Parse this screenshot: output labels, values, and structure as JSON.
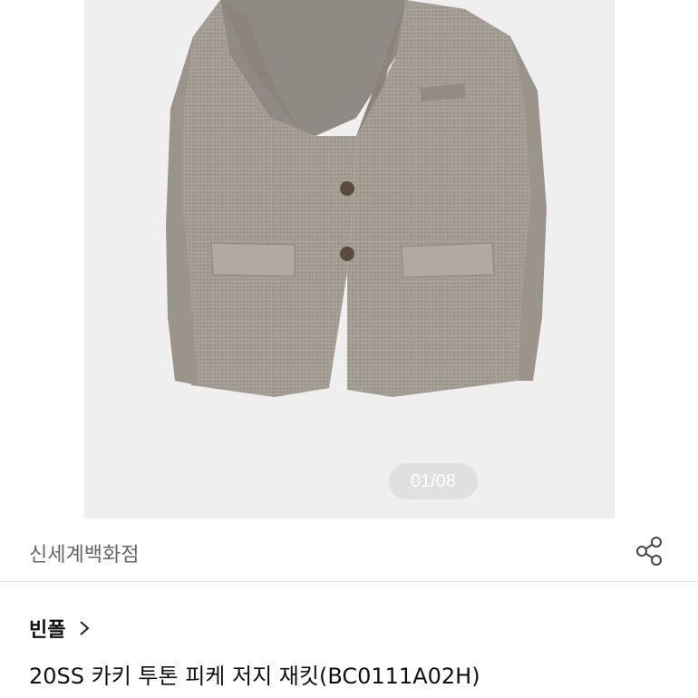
{
  "gallery": {
    "image_alt": "jacket-photo",
    "counter": "01/08"
  },
  "store": {
    "name": "신세계백화점",
    "share_icon": "share-icon"
  },
  "product": {
    "brand": "빈폴",
    "brand_chevron_icon": "chevron-right-icon",
    "title": "20SS 카키 투톤 피케 저지 재킷(BC0111A02H)"
  },
  "colors": {
    "jacket": "#a39d94",
    "background_photo": "#efefef",
    "counter_pill": "#e0e0e0"
  }
}
